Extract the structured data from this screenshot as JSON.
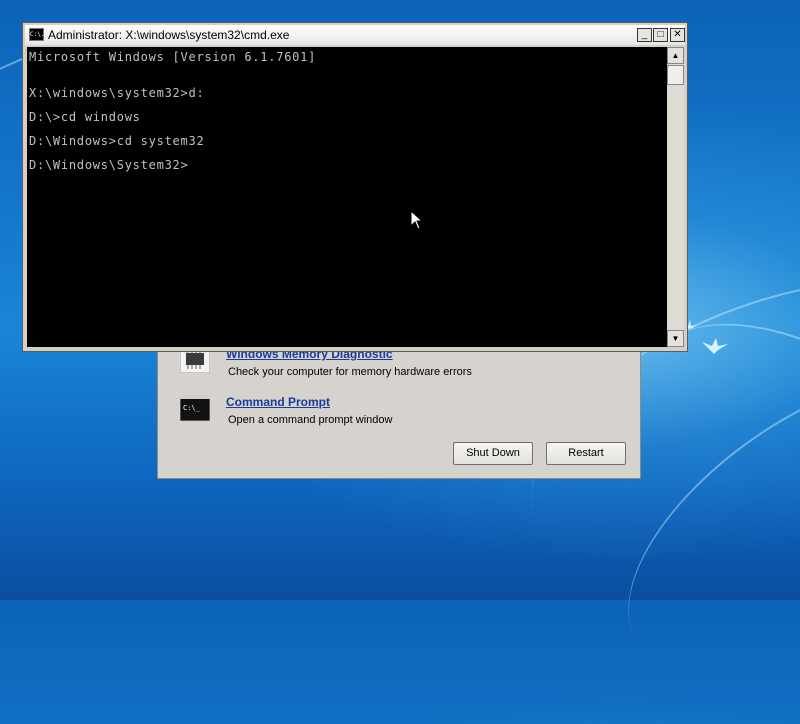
{
  "cmd": {
    "title": "Administrator: X:\\windows\\system32\\cmd.exe",
    "app_icon_text": "C:\\.",
    "controls": {
      "minimize": "_",
      "maximize": "□",
      "close": "✕"
    },
    "lines": [
      "Microsoft Windows [Version 6.1.7601]",
      "",
      "X:\\windows\\system32>d:",
      "",
      "D:\\>cd windows",
      "",
      "D:\\Windows>cd system32",
      "",
      "D:\\Windows\\System32>"
    ],
    "scroll_up": "▲",
    "scroll_down": "▼"
  },
  "recovery": {
    "options": [
      {
        "label": "Windows Memory Diagnostic",
        "description": "Check your computer for memory hardware errors",
        "icon": "memory-chip-icon"
      },
      {
        "label": "Command Prompt",
        "description": "Open a command prompt window",
        "icon": "command-prompt-icon"
      }
    ],
    "shutdown_label": "Shut Down",
    "restart_label": "Restart"
  },
  "colors": {
    "console_bg": "#000000",
    "console_text": "#c0c0c0",
    "link": "#1a3a9c",
    "dialog_bg": "#d6d3ce"
  }
}
